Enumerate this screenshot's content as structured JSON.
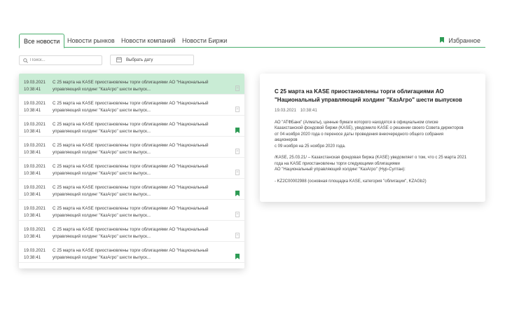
{
  "tabs": [
    {
      "label": "Все новости",
      "active": true
    },
    {
      "label": "Новости рынков"
    },
    {
      "label": "Новости компаний"
    },
    {
      "label": "Новости Биржи"
    }
  ],
  "favorites_label": "Избранное",
  "search": {
    "placeholder": "Поиск..."
  },
  "date_button": "Выбрать дату",
  "accent_color": "#4caf6f",
  "news": [
    {
      "date": "19.03.2021",
      "time": "10:38:41",
      "title": "С 25 марта на KASE приостановлены торги облигациями АО \"Национальный управляющий холдинг \"КазАгро\" шести выпуск...",
      "favorite": false,
      "selected": true
    },
    {
      "date": "19.03.2021",
      "time": "10:38:41",
      "title": "С 25 марта на KASE приостановлены торги облигациями АО \"Национальный управляющий холдинг \"КазАгро\" шести выпуск...",
      "favorite": false
    },
    {
      "date": "19.03.2021",
      "time": "10:38:41",
      "title": "С 25 марта на KASE приостановлены торги облигациями АО \"Национальный управляющий холдинг \"КазАгро\" шести выпуск...",
      "favorite": true
    },
    {
      "date": "19.03.2021",
      "time": "10:38:41",
      "title": "С 25 марта на KASE приостановлены торги облигациями АО \"Национальный управляющий холдинг \"КазАгро\" шести выпуск...",
      "favorite": false
    },
    {
      "date": "19.03.2021",
      "time": "10:38:41",
      "title": "С 25 марта на KASE приостановлены торги облигациями АО \"Национальный управляющий холдинг \"КазАгро\" шести выпуск...",
      "favorite": false
    },
    {
      "date": "19.03.2021",
      "time": "10:38:41",
      "title": "С 25 марта на KASE приостановлены торги облигациями АО \"Национальный управляющий холдинг \"КазАгро\" шести выпуск...",
      "favorite": true
    },
    {
      "date": "19.03.2021",
      "time": "10:38:41",
      "title": "С 25 марта на KASE приостановлены торги облигациями АО \"Национальный управляющий холдинг \"КазАгро\" шести выпуск...",
      "favorite": false
    },
    {
      "date": "19.03.2021",
      "time": "10:38:41",
      "title": "С 25 марта на KASE приостановлены торги облигациями АО \"Национальный управляющий холдинг \"КазАгро\" шести выпуск...",
      "favorite": false
    },
    {
      "date": "19.03.2021",
      "time": "10:38:41",
      "title": "С 25 марта на KASE приостановлены торги облигациями АО \"Национальный управляющий холдинг \"КазАгро\" шести выпуск...",
      "favorite": true
    }
  ],
  "detail": {
    "title": "С 25 марта на KASE приостановлены торги облигациями АО \"Национальный управляющий холдинг \"КазАгро\" шести выпусков",
    "date": "19.03.2021",
    "time": "10:38:41",
    "paragraphs": [
      "АО \"АТФБанк\" (Алматы), ценные бумаги которого находятся в официальном списке\nКазахстанской фондовой биржи (KASE), уведомило KASE о решении своего Совета директоров\nот 04 ноября 2020 года о переносе даты проведения внеочередного общего собрания\nакционеров\nс 09 ноября на 25 ноября 2020 года.",
      "/KASE, 25.03.21/ – Казахстанская фондовая биржа (KASE) уведомляет о том, что с 25 марта 2021\nгода на KASE приостановлены торги следующими облигациями\nАО \"Национальный управляющий холдинг \"КазАгро\" (Нур-Султан):",
      "- KZ2C00002988 (основная площадка KASE, категория \"облигации\", KZAGb2)"
    ]
  }
}
